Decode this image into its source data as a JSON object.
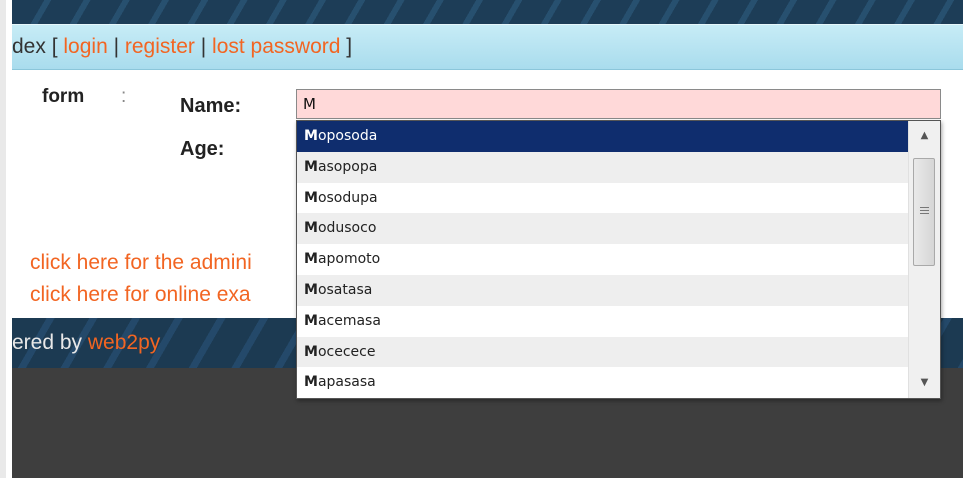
{
  "nav": {
    "prefix": "dex [ ",
    "login": "login",
    "sep1": " | ",
    "register": "register",
    "sep2": " | ",
    "lost_password": "lost password",
    "suffix": " ]"
  },
  "form": {
    "title": "form",
    "colon": ":",
    "name_label": "Name:",
    "age_label": "Age:",
    "name_value": "M"
  },
  "links": {
    "admin": "click here for the admini",
    "exam": "click here for online exa"
  },
  "footer": {
    "prefix": "ered by ",
    "link": "web2py"
  },
  "autocomplete": {
    "items": [
      {
        "bold": "M",
        "rest": "oposoda"
      },
      {
        "bold": "M",
        "rest": "asopopa"
      },
      {
        "bold": "M",
        "rest": "osodupa"
      },
      {
        "bold": "M",
        "rest": "odusoco"
      },
      {
        "bold": "M",
        "rest": "apomoto"
      },
      {
        "bold": "M",
        "rest": "osatasa"
      },
      {
        "bold": "M",
        "rest": "acemasa"
      },
      {
        "bold": "M",
        "rest": "ocecece"
      },
      {
        "bold": "M",
        "rest": "apasasa"
      }
    ],
    "selected_index": 0
  },
  "icons": {
    "scroll_up": "▲",
    "scroll_down": "▼"
  },
  "colors": {
    "link": "#f26522",
    "selected": "#0f2d6e",
    "input_bg": "#ffd9d9"
  }
}
